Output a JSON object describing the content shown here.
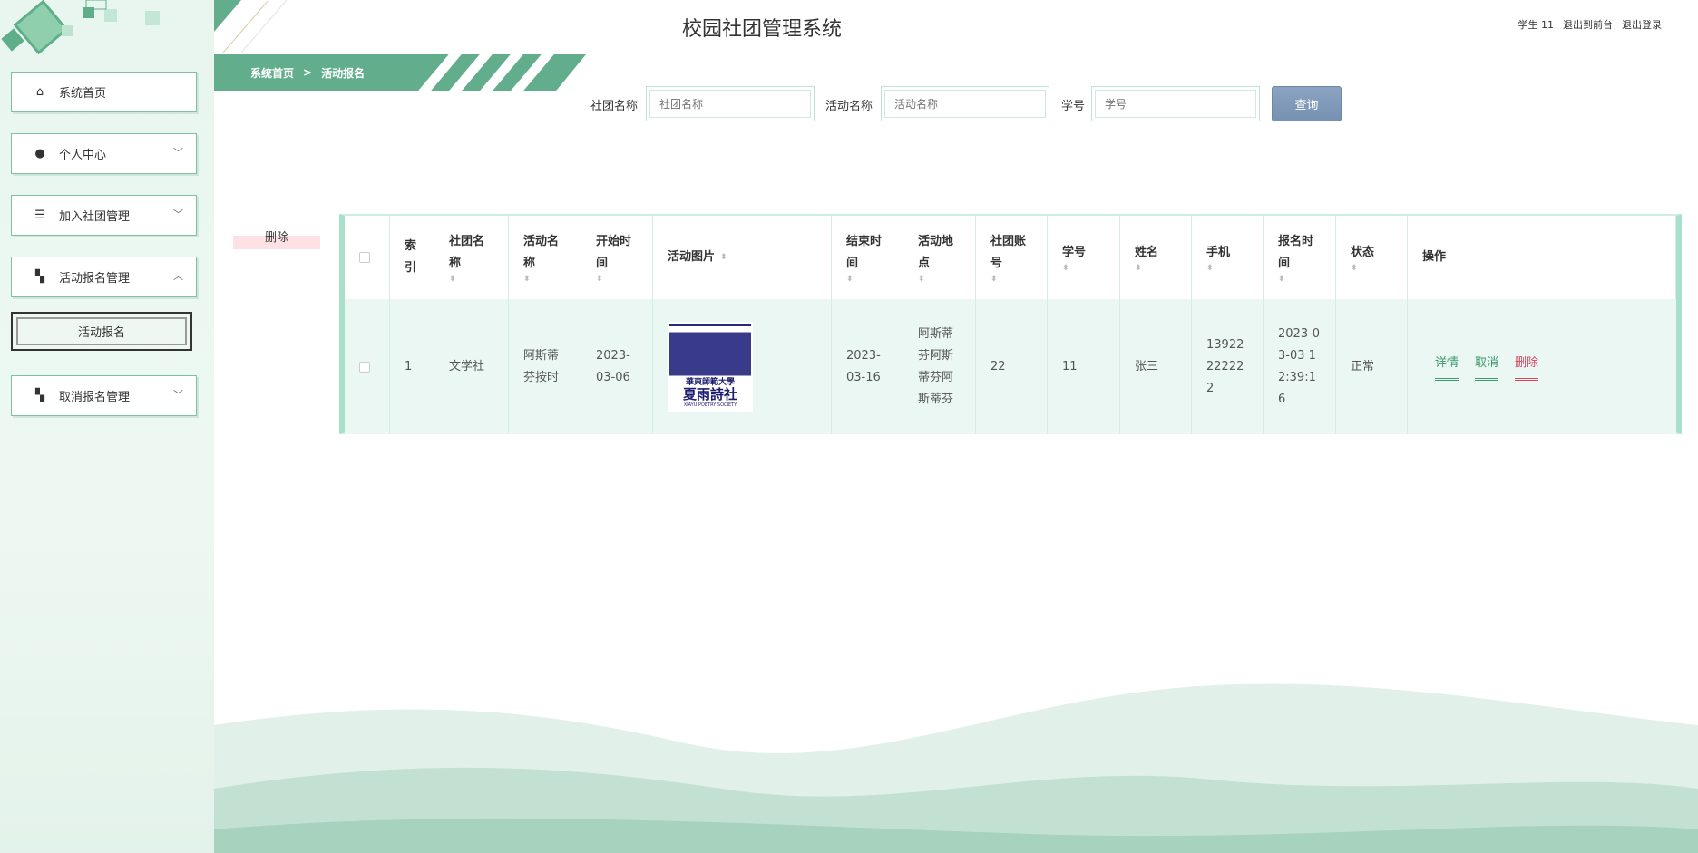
{
  "header": {
    "title": "校园社团管理系统",
    "user": "学生 11",
    "to_front": "退出到前台",
    "logout": "退出登录"
  },
  "breadcrumb": {
    "home": "系统首页",
    "sep": ">",
    "current": "活动报名"
  },
  "sidebar": {
    "items": [
      {
        "label": "系统首页",
        "icon": "home-icon"
      },
      {
        "label": "个人中心",
        "icon": "user-icon"
      },
      {
        "label": "加入社团管理",
        "icon": "list-icon"
      },
      {
        "label": "活动报名管理",
        "icon": "grid-icon"
      },
      {
        "label": "取消报名管理",
        "icon": "grid-icon"
      }
    ],
    "sub_item": "活动报名"
  },
  "search": {
    "club_label": "社团名称",
    "club_placeholder": "社团名称",
    "activity_label": "活动名称",
    "activity_placeholder": "活动名称",
    "student_label": "学号",
    "student_placeholder": "学号",
    "button": "查询"
  },
  "toolbar": {
    "delete": "删除"
  },
  "table": {
    "headers": [
      "索引",
      "社团名称",
      "活动名称",
      "开始时间",
      "活动图片",
      "结束时间",
      "活动地点",
      "社团账号",
      "学号",
      "姓名",
      "手机",
      "报名时间",
      "状态",
      "操作"
    ],
    "row": {
      "index": "1",
      "club": "文学社",
      "activity": "阿斯蒂芬按时",
      "start": "2023-03-06",
      "image_text": "華東師範大學 夏雨詩社 XIAYU POETRY SOCIETY",
      "end": "2023-03-16",
      "location": "阿斯蒂芬阿斯蒂芬阿斯蒂芬",
      "club_account": "22",
      "student_no": "11",
      "name": "张三",
      "phone": "13922222222",
      "signup_time": "2023-03-03 12:39:16",
      "status": "正常"
    },
    "actions": [
      "详情",
      "取消",
      "删除"
    ]
  },
  "colors": {
    "primary": "#62ad8c",
    "danger": "#d9455f",
    "button": "#7f98b8"
  }
}
